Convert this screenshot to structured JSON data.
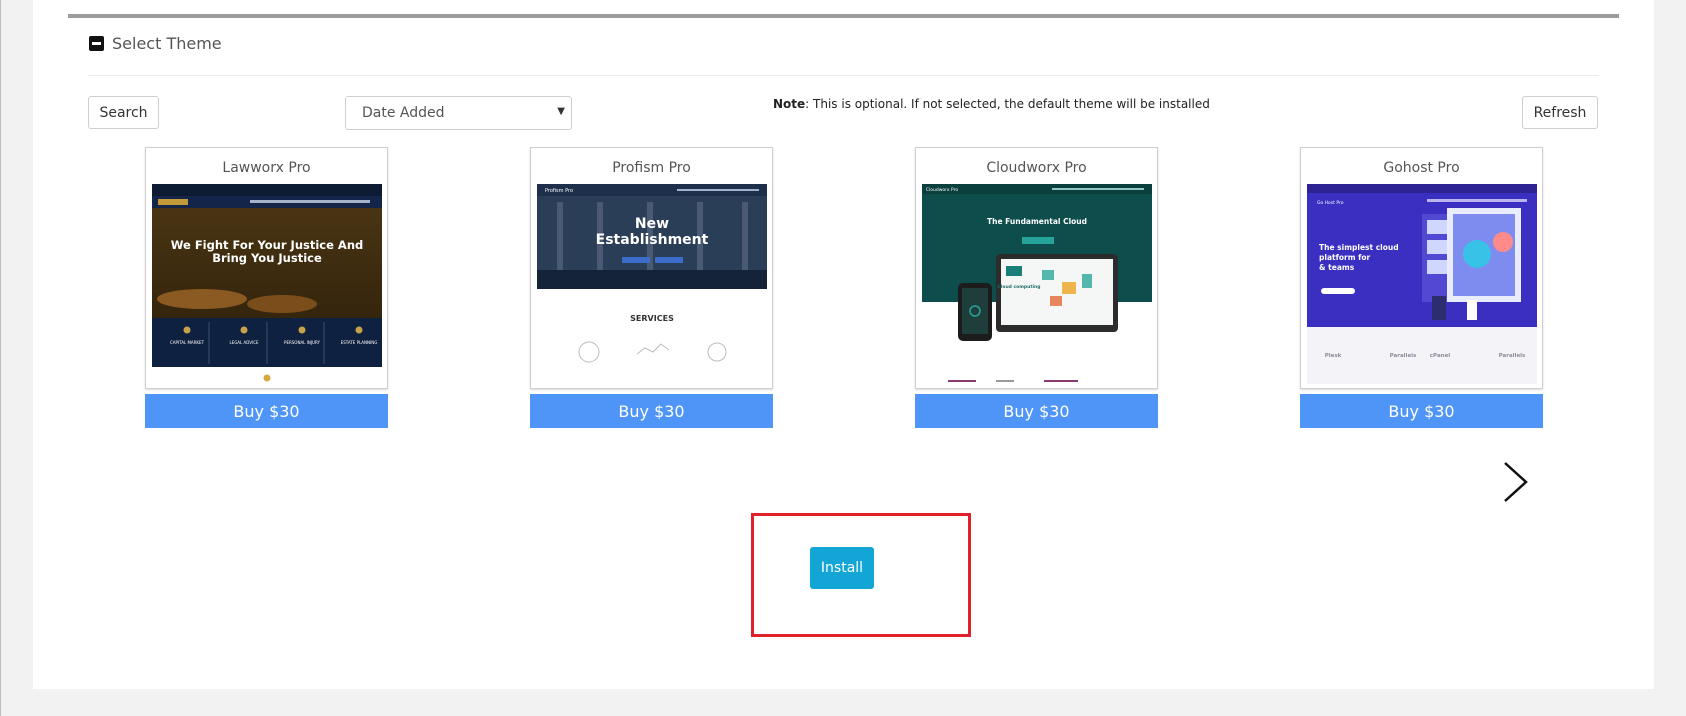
{
  "section": {
    "title": "Select Theme",
    "collapse_icon": "minus-square-icon"
  },
  "toolbar": {
    "search_label": "Search",
    "sort_value": "Date Added",
    "note_label": "Note",
    "note_text": ": This is optional. If not selected, the default theme will be installed",
    "refresh_label": "Refresh"
  },
  "themes": [
    {
      "name": "Lawworx Pro",
      "buy_label": "Buy  $30",
      "preview": {
        "headline1": "We Fight For Your Justice And",
        "headline2": "Bring You Justice",
        "features": [
          "CAPITAL MARKET",
          "LEGAL ADVICE",
          "PERSONAL INJURY",
          "ESTATE PLANNING"
        ]
      }
    },
    {
      "name": "Profism Pro",
      "buy_label": "Buy  $30",
      "preview": {
        "brand": "Profism Pro",
        "headline1": "New",
        "headline2": "Establishment",
        "section": "SERVICES"
      }
    },
    {
      "name": "Cloudworx Pro",
      "buy_label": "Buy  $30",
      "preview": {
        "brand": "Cloudworx Pro",
        "headline": "The Fundamental Cloud",
        "device_text": "Cloud computing"
      }
    },
    {
      "name": "Gohost Pro",
      "buy_label": "Buy  $30",
      "preview": {
        "brand": "Go Host Pro",
        "headline1": "The simplest cloud",
        "headline2": "platform for",
        "headline3": "& teams",
        "logos": [
          "Plesk",
          "Parallels",
          "cPanel",
          "Parallels"
        ]
      }
    }
  ],
  "carousel": {
    "next_icon": "chevron-right-icon"
  },
  "install": {
    "label": "Install"
  },
  "colors": {
    "buy_button": "#4f95f7",
    "install_button": "#12a5d6",
    "highlight": "#e0202a"
  }
}
